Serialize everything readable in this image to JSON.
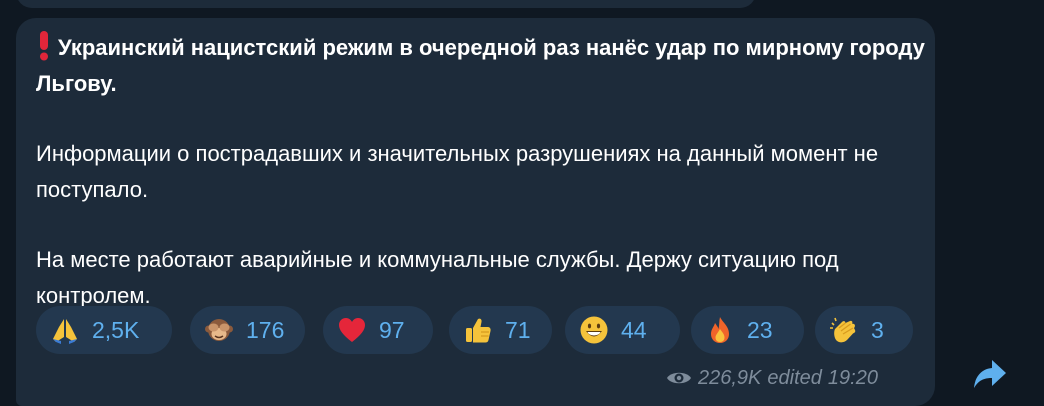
{
  "message": {
    "headline": "Украинский нацистский режим в очередной раз нанёс удар по мирному городу Льгову.",
    "paragraph_1": "Информации о пострадавших и значительных разрушениях на данный момент не поступало.",
    "paragraph_2": "На месте работают аварийные и коммунальные службы. Держу ситуацию под контролем.",
    "headline_icon": "red-exclamation-icon"
  },
  "reactions": [
    {
      "icon": "praying-hands-icon",
      "count": "2,5K"
    },
    {
      "icon": "see-no-evil-monkey-icon",
      "count": "176"
    },
    {
      "icon": "red-heart-icon",
      "count": "97"
    },
    {
      "icon": "thumbs-up-icon",
      "count": "71"
    },
    {
      "icon": "grinning-face-icon",
      "count": "44"
    },
    {
      "icon": "fire-icon",
      "count": "23"
    },
    {
      "icon": "clapping-hands-icon",
      "count": "3"
    }
  ],
  "meta": {
    "views": "226,9K",
    "edited_label": "edited",
    "time": "19:20"
  },
  "colors": {
    "background": "#0f1822",
    "bubble": "#1d2b3a",
    "reaction_chip": "#23384f",
    "reaction_count": "#5fb0ee",
    "meta_text": "#7e8c9b",
    "share": "#5fb0ee"
  }
}
